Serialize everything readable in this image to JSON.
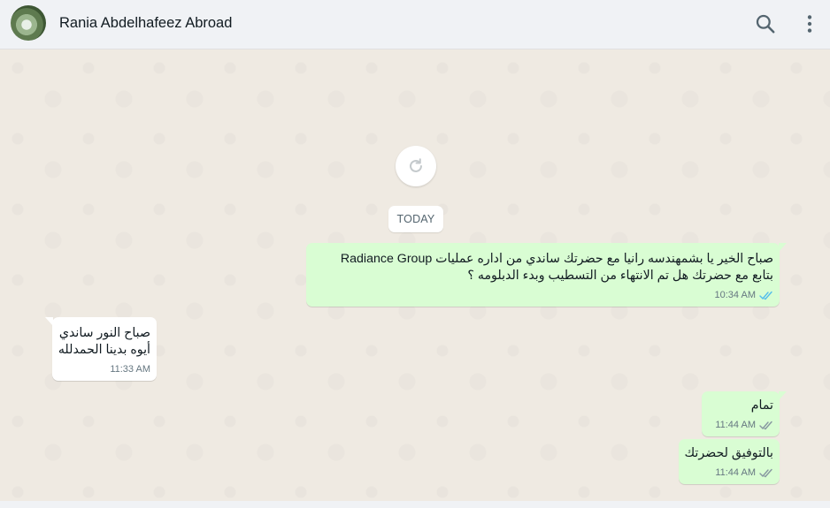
{
  "header": {
    "contact_name": "Rania Abdelhafeez Abroad",
    "icons": [
      "avatar",
      "search-icon",
      "menu-icon"
    ]
  },
  "chat": {
    "date_separator": "TODAY",
    "messages": [
      {
        "direction": "outgoing",
        "text": "صباح الخير يا بشمهندسه رانيا مع حضرتك ساندي من اداره عمليات Radiance Group\nبتابع مع حضرتك هل تم الانتهاء من التسطيب وبدء الدبلومه ؟",
        "time": "10:34 AM",
        "status": "read"
      },
      {
        "direction": "incoming",
        "text": "صباح النور ساندي\nأيوه بدينا الحمدلله",
        "time": "11:33 AM"
      },
      {
        "direction": "outgoing",
        "text": "تمام",
        "time": "11:44 AM",
        "status": "delivered"
      },
      {
        "direction": "outgoing",
        "text": "بالتوفيق لحضرتك",
        "time": "11:44 AM",
        "status": "delivered"
      }
    ]
  },
  "colors": {
    "outgoing_bubble": "#d9fdd3",
    "incoming_bubble": "#ffffff",
    "read_ticks": "#53bdeb",
    "delivered_ticks": "#8696a0",
    "chat_background": "#efeae2"
  }
}
